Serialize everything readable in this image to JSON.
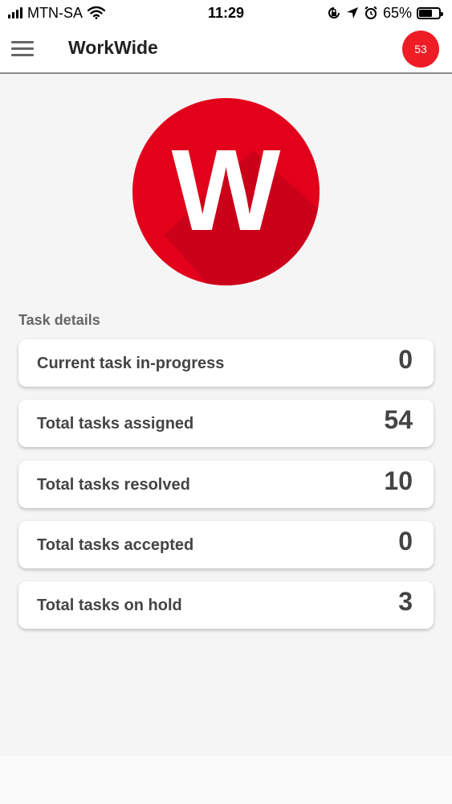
{
  "status_bar": {
    "carrier": "MTN-SA",
    "time": "11:29",
    "battery_percent": "65%",
    "battery_level": 0.65
  },
  "app_bar": {
    "title": "WorkWide",
    "notification_count": "53"
  },
  "logo": {
    "letter": "W",
    "color": "#e2001a"
  },
  "section": {
    "title": "Task details"
  },
  "tasks": [
    {
      "label": "Current task in-progress",
      "count": "0"
    },
    {
      "label": "Total tasks assigned",
      "count": "54"
    },
    {
      "label": "Total tasks resolved",
      "count": "10"
    },
    {
      "label": "Total tasks accepted",
      "count": "0"
    },
    {
      "label": "Total tasks on hold",
      "count": "3"
    }
  ],
  "colors": {
    "accent": "#ee1c25",
    "background": "#f5f5f6",
    "card": "#ffffff"
  }
}
